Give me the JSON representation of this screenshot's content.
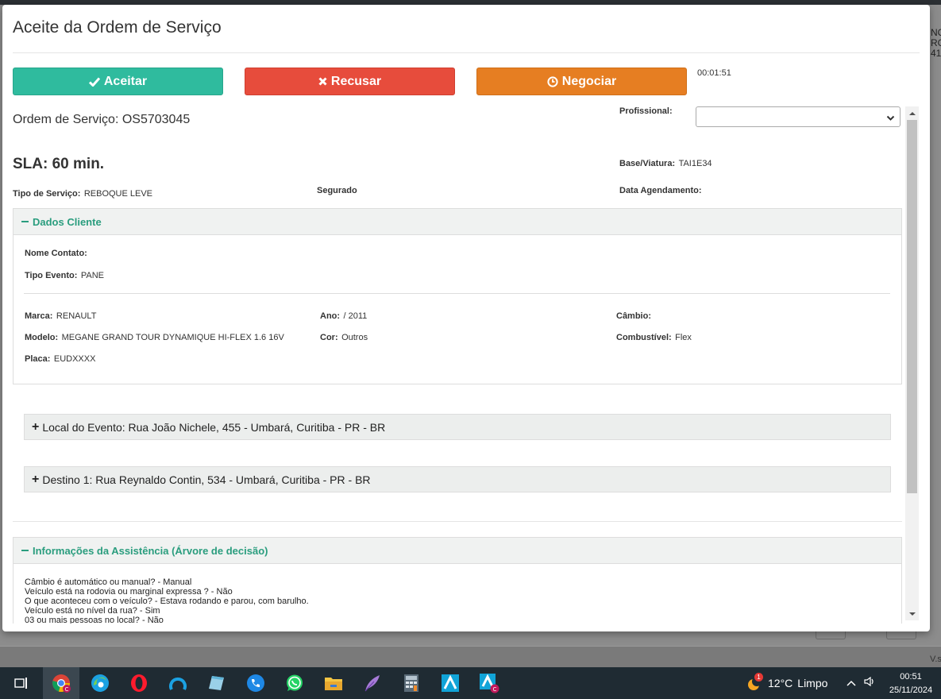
{
  "modal": {
    "title": "Aceite da Ordem de Serviço",
    "actions": {
      "accept_label": "Aceitar",
      "refuse_label": "Recusar",
      "negotiate_label": "Negociar",
      "timer": "00:01:51"
    },
    "colors": {
      "accept": "#2fbb9e",
      "refuse": "#e74c3c",
      "negotiate": "#e67e22",
      "section_title": "#2a9d7e"
    }
  },
  "order": {
    "label": "Ordem de Serviço:",
    "number": "OS5703045",
    "sla": "SLA: 60 min.",
    "professional_label": "Profissional:",
    "professional_value": "",
    "base_label": "Base/Viatura:",
    "base_value": "TAI1E34",
    "service_type_label": "Tipo de Serviço:",
    "service_type_value": "REBOQUE LEVE",
    "insured_label": "Segurado",
    "schedule_label": "Data Agendamento:"
  },
  "client": {
    "header": "Dados Cliente",
    "contact_label": "Nome Contato:",
    "contact_value": "",
    "event_type_label": "Tipo Evento:",
    "event_type_value": "PANE",
    "brand_label": "Marca:",
    "brand_value": "RENAULT",
    "year_label": "Ano:",
    "year_value": "/ 2011",
    "gear_label": "Câmbio:",
    "gear_value": "",
    "model_label": "Modelo:",
    "model_value": "MEGANE GRAND TOUR DYNAMIQUE HI-FLEX 1.6 16V",
    "color_label": "Cor:",
    "color_value": "Outros",
    "fuel_label": "Combustível:",
    "fuel_value": "Flex",
    "plate_label": "Placa:",
    "plate_value": "EUDXXXX"
  },
  "locations": {
    "event": "Local do Evento: Rua João Nichele, 455 - Umbará, Curitiba - PR - BR",
    "destination": "Destino 1: Rua Reynaldo Contin, 534 - Umbará, Curitiba - PR - BR"
  },
  "assistance": {
    "header": "Informações da Assistência (Árvore de decisão)",
    "lines": [
      "Câmbio é automático ou manual? - Manual",
      "Veículo está na rodovia ou marginal expressa ? - Não",
      "O que aconteceu com o veículo? - Estava rodando e parou, com barulho.",
      "Veículo está no nível da rua? - Sim",
      "03 ou mais pessoas no local? - Não"
    ]
  },
  "background": {
    "right_text": [
      "NC",
      "RG",
      "41"
    ],
    "version": "V.s"
  },
  "taskbar": {
    "weather_temp": "12°C",
    "weather_desc": "Limpo",
    "weather_badge": "1",
    "time": "00:51",
    "date": "25/11/2024",
    "icons": [
      "task-view-icon",
      "chrome-icon",
      "edge-icon",
      "opera-icon",
      "app-a-icon",
      "notes-icon",
      "phone-icon",
      "whatsapp-icon",
      "folder-icon",
      "feather-icon",
      "calculator-icon",
      "app-a2-icon",
      "app-a3-icon"
    ]
  }
}
